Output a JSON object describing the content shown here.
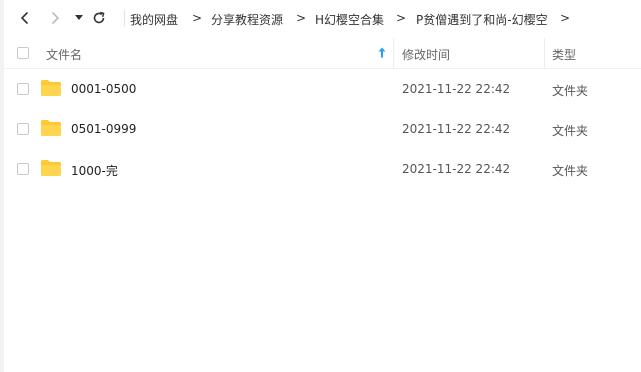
{
  "toolbar": {
    "back_icon": "chevron-left-icon",
    "forward_icon": "chevron-right-icon",
    "dropdown_icon": "caret-down-icon",
    "refresh_icon": "refresh-icon",
    "breadcrumb": [
      {
        "label": "我的网盘"
      },
      {
        "label": "分享教程资源"
      },
      {
        "label": "H幻樱空合集"
      },
      {
        "label": "P贫僧遇到了和尚-幻樱空"
      }
    ],
    "separator": ">"
  },
  "header": {
    "name_label": "文件名",
    "modified_label": "修改时间",
    "type_label": "类型",
    "sort_icon": "sort-ascending-icon"
  },
  "rows": [
    {
      "name": "0001-0500",
      "modified": "2021-11-22 22:42",
      "type": "文件夹",
      "icon": "folder-icon"
    },
    {
      "name": "0501-0999",
      "modified": "2021-11-22 22:42",
      "type": "文件夹",
      "icon": "folder-icon"
    },
    {
      "name": "1000-完",
      "modified": "2021-11-22 22:42",
      "type": "文件夹",
      "icon": "folder-icon"
    }
  ],
  "colors": {
    "folder": "#ffd44e",
    "sort_accent": "#2b9ef5",
    "border": "#eeeeee"
  }
}
